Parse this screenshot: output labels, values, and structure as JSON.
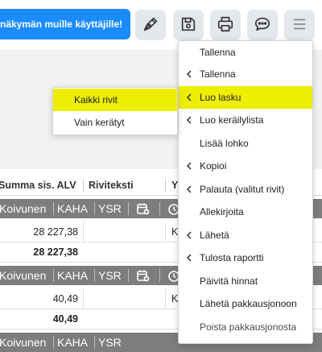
{
  "toolbar": {
    "share_button": "näkymän muille käyttäjille!",
    "buttons": [
      {
        "icon": "pen-nib-icon"
      },
      {
        "icon": "save-icon"
      },
      {
        "icon": "print-icon"
      },
      {
        "icon": "comment-icon"
      },
      {
        "icon": "menu-icon"
      }
    ]
  },
  "table": {
    "columns": [
      "Summa sis. ALV",
      "Riviteksti",
      "Y"
    ],
    "group_rows": [
      {
        "name": "Koivunen",
        "code1": "KAHA",
        "code2": "YSR"
      },
      {
        "name": "Koivunen",
        "code1": "KAHA",
        "code2": "YSR"
      },
      {
        "name": "Koivunen",
        "code1": "KAHA",
        "code2": "YSR"
      }
    ],
    "data_rows": [
      {
        "amount": "28 227,38",
        "tail": "K"
      },
      {
        "amount": "28 227,38",
        "tail": "",
        "bold": true
      },
      {
        "amount": "40,49",
        "tail": "K"
      },
      {
        "amount": "40,49",
        "tail": "",
        "bold": true
      }
    ]
  },
  "menu": {
    "items": [
      {
        "label": "Tallenna",
        "submenu": false
      },
      {
        "label": "Tallenna",
        "submenu": true
      },
      {
        "label": "Luo lasku",
        "submenu": true,
        "highlighted": true
      },
      {
        "label": "Luo keräilylista",
        "submenu": true
      },
      {
        "label": "Lisää lohko",
        "submenu": false
      },
      {
        "label": "Kopioi",
        "submenu": true
      },
      {
        "label": "Palauta (valitut rivit)",
        "submenu": true
      },
      {
        "label": "Allekirjoita",
        "submenu": false
      },
      {
        "label": "Lähetä",
        "submenu": true
      },
      {
        "label": "Tulosta raportti",
        "submenu": true
      },
      {
        "label": "Päivitä hinnat",
        "submenu": false
      },
      {
        "label": "Lähetä pakkausjonoon",
        "submenu": false
      },
      {
        "label": "Poista pakkausjonosta",
        "submenu": false,
        "muted": true
      }
    ]
  },
  "submenu": {
    "items": [
      {
        "label": "Kaikki rivit",
        "highlighted": true
      },
      {
        "label": "Vain kerätyt"
      }
    ]
  },
  "colors": {
    "accent": "#1a8cff",
    "highlight": "#eeee00",
    "group_row": "#7d7d7d",
    "toolbar_button": "#e4e7eb"
  }
}
